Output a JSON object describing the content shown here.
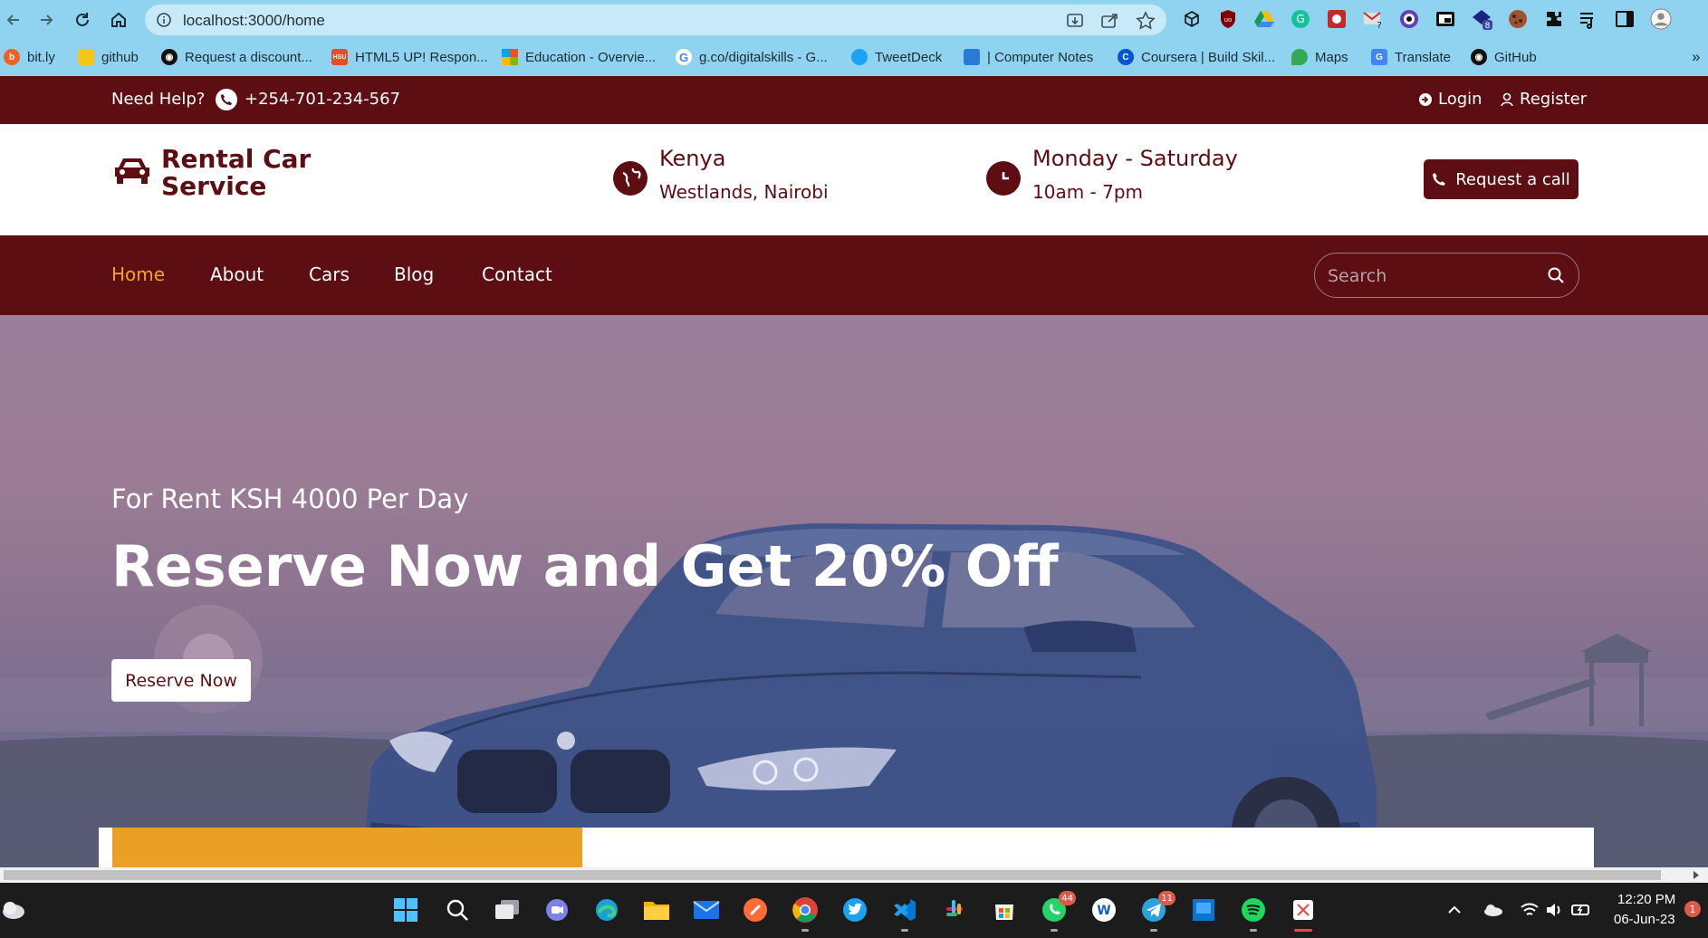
{
  "browser": {
    "url": "localhost:3000/home",
    "extension_badges": {
      "grammarly_question": "?",
      "ext_count": "8"
    },
    "bookmarks": [
      {
        "label": "bit.ly",
        "icon": "bitly-icon",
        "color": "#ee6123"
      },
      {
        "label": "github",
        "icon": "folder-icon",
        "color": "#f5c518"
      },
      {
        "label": "Request a discount...",
        "icon": "github-icon",
        "color": "#111111"
      },
      {
        "label": "HTML5 UP! Respon...",
        "icon": "hsu-icon",
        "color": "#e44d26"
      },
      {
        "label": "Education - Overvie...",
        "icon": "microsoft-icon",
        "color": "#f25022"
      },
      {
        "label": "g.co/digitalskills - G...",
        "icon": "google-icon",
        "color": "#4285f4"
      },
      {
        "label": "TweetDeck",
        "icon": "twitter-icon",
        "color": "#1da1f2"
      },
      {
        "label": "| Computer Notes",
        "icon": "notes-icon",
        "color": "#2b7bd6"
      },
      {
        "label": "Coursera | Build Skil...",
        "icon": "coursera-icon",
        "color": "#0056d2"
      },
      {
        "label": "Maps",
        "icon": "maps-icon",
        "color": "#34a853"
      },
      {
        "label": "Translate",
        "icon": "translate-icon",
        "color": "#4285f4"
      },
      {
        "label": "GitHub",
        "icon": "github-icon",
        "color": "#111111"
      }
    ],
    "overflow_label": "»"
  },
  "topbar": {
    "need_help": "Need Help?",
    "phone": "+254-701-234-567",
    "login": "Login",
    "register": "Register"
  },
  "header": {
    "logo_line1": "Rental Car",
    "logo_line2": "Service",
    "location_title": "Kenya",
    "location_sub": "Westlands, Nairobi",
    "hours_title": "Monday - Saturday",
    "hours_sub": "10am - 7pm",
    "request_call": "Request a call"
  },
  "nav": {
    "items": [
      "Home",
      "About",
      "Cars",
      "Blog",
      "Contact"
    ],
    "active": "Home",
    "search_placeholder": "Search"
  },
  "hero": {
    "subtitle": "For Rent KSH 4000 Per Day",
    "title": "Reserve Now and Get 20% Off",
    "button": "Reserve Now"
  },
  "taskbar": {
    "whatsapp_badge": "44",
    "telegram_badge": "11",
    "time": "12:20 PM",
    "date": "06-Jun-23",
    "notification_count": "1"
  },
  "colors": {
    "brand": "#5c0e13",
    "accent": "#f0a71f",
    "booking_accent": "#e9a024",
    "chrome": "#8fd3f0"
  }
}
